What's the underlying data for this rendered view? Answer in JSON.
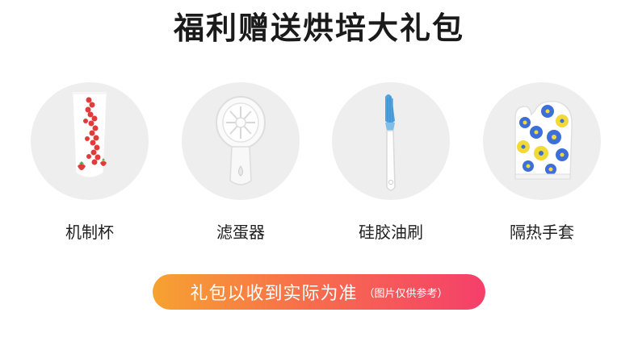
{
  "title": "福利赠送烘培大礼包",
  "items": [
    {
      "label": "机制杯",
      "icon": "cup-icon"
    },
    {
      "label": "滤蛋器",
      "icon": "egg-separator-icon"
    },
    {
      "label": "硅胶油刷",
      "icon": "silicone-brush-icon"
    },
    {
      "label": "隔热手套",
      "icon": "oven-mitt-icon"
    }
  ],
  "notice": {
    "main": "礼包以收到实际为准",
    "sub": "（图片仅供参考）"
  },
  "colors": {
    "circle_bg": "#eeeeee",
    "pill_gradient_start": "#f7a231",
    "pill_gradient_end": "#f53f6b",
    "brush_blue": "#4fa3e0",
    "strawberry_red": "#e23b3b",
    "flower_blue": "#3d6fd8",
    "flower_yellow": "#f2d93a"
  }
}
